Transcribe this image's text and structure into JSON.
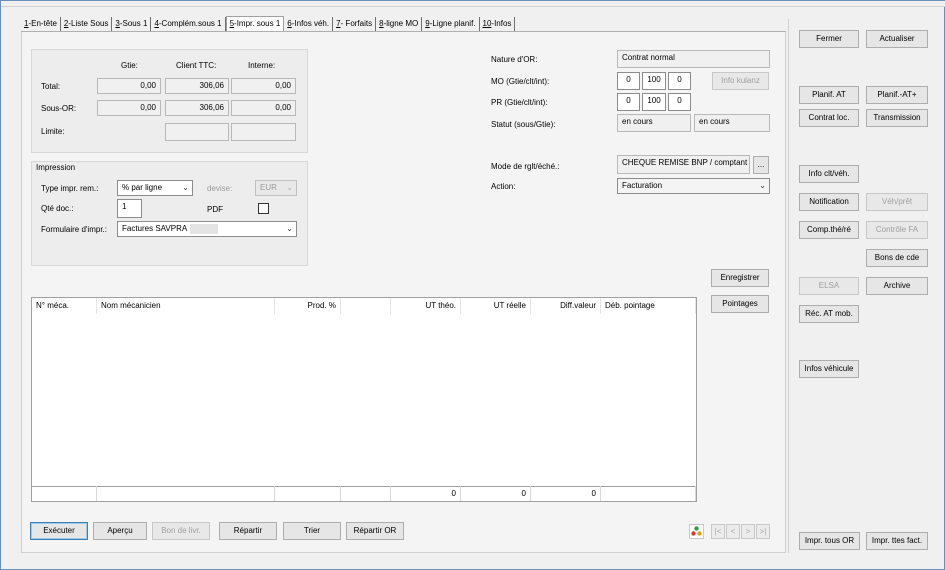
{
  "tabs": [
    {
      "key": "1",
      "label": "-En-tête"
    },
    {
      "key": "2",
      "label": "-Liste Sous"
    },
    {
      "key": "3",
      "label": "-Sous 1"
    },
    {
      "key": "4",
      "label": "-Complém.sous 1"
    },
    {
      "key": "5",
      "label": "-Impr. sous 1"
    },
    {
      "key": "6",
      "label": "-Infos véh."
    },
    {
      "key": "7",
      "label": "- Forfaits"
    },
    {
      "key": "8",
      "label": "-ligne MO"
    },
    {
      "key": "9",
      "label": "-Ligne planif."
    },
    {
      "key": "10",
      "label": "-Infos"
    }
  ],
  "totals": {
    "col_gtie": "Gtie:",
    "col_client": "Client TTC:",
    "col_interne": "Interne:",
    "row_total": "Total:",
    "row_sousor": "Sous-OR:",
    "row_limite": "Limite:",
    "total_gtie": "0,00",
    "total_client": "306,06",
    "total_interne": "0,00",
    "sousor_gtie": "0,00",
    "sousor_client": "306,06",
    "sousor_interne": "0,00"
  },
  "impression": {
    "title": "Impression",
    "type_label": "Type impr. rem.:",
    "type_value": "% par ligne",
    "devise_label": "devise:",
    "devise_value": "EUR",
    "qte_label": "Qté doc.:",
    "qte_value": "1",
    "pdf_label": "PDF",
    "form_label": "Formulaire d'impr.:",
    "form_value": "Factures SAVPRA"
  },
  "right_info": {
    "nature_label": "Nature d'OR:",
    "nature_value": "Contrat normal",
    "mo_label": "MO (Gtie/clt/int):",
    "mo_values": [
      "0",
      "100",
      "0"
    ],
    "info_kulanz": "Info kulanz",
    "pr_label": "PR (Gtie/clt/int):",
    "pr_values": [
      "0",
      "100",
      "0"
    ],
    "statut_label": "Statut (sous/Gtie):",
    "statut_sous": "en cours",
    "statut_gtie": "en cours",
    "mode_label": "Mode de rglt/éché.:",
    "mode_value": "CHEQUE REMISE BNP / comptant",
    "mode_btn": "...",
    "action_label": "Action:",
    "action_value": "Facturation"
  },
  "buttons": {
    "enregistrer": "Enregistrer",
    "pointages": "Pointages",
    "executer": "Exécuter",
    "apercu": "Aperçu",
    "bon_livr": "Bon de livr.",
    "repartir": "Répartir",
    "trier": "Trier",
    "repartir_or": "Répartir OR"
  },
  "table": {
    "headers": [
      "N° méca.",
      "Nom mécanicien",
      "Prod. %",
      "",
      "UT théo.",
      "UT réelle",
      "Diff.valeur",
      "Déb. pointage"
    ],
    "footer": [
      "",
      "",
      "",
      "",
      "0",
      "0",
      "0",
      ""
    ]
  },
  "nav": [
    "|<",
    "<",
    ">",
    ">|"
  ],
  "sidebar": {
    "fermer": "Fermer",
    "actualiser": "Actualiser",
    "planif_at": "Planif. AT",
    "planif_at_plus": "Planif.-AT+",
    "contrat_loc": "Contrat loc.",
    "transmission": "Transmission",
    "info_clt_veh": "Info clt/véh.",
    "notification": "Notification",
    "veh_pret": "Véh/prêt",
    "comp_the_re": "Comp.thé/ré",
    "controle_fa": "Contrôle FA",
    "bons_de_cde": "Bons de cde",
    "elsa": "ELSA",
    "archive": "Archive",
    "rec_at_mob": "Réc. AT mob.",
    "infos_vehicule": "Infos véhicule",
    "impr_tous_or": "Impr. tous OR",
    "impr_ttes_fact": "Impr. ttes fact."
  }
}
